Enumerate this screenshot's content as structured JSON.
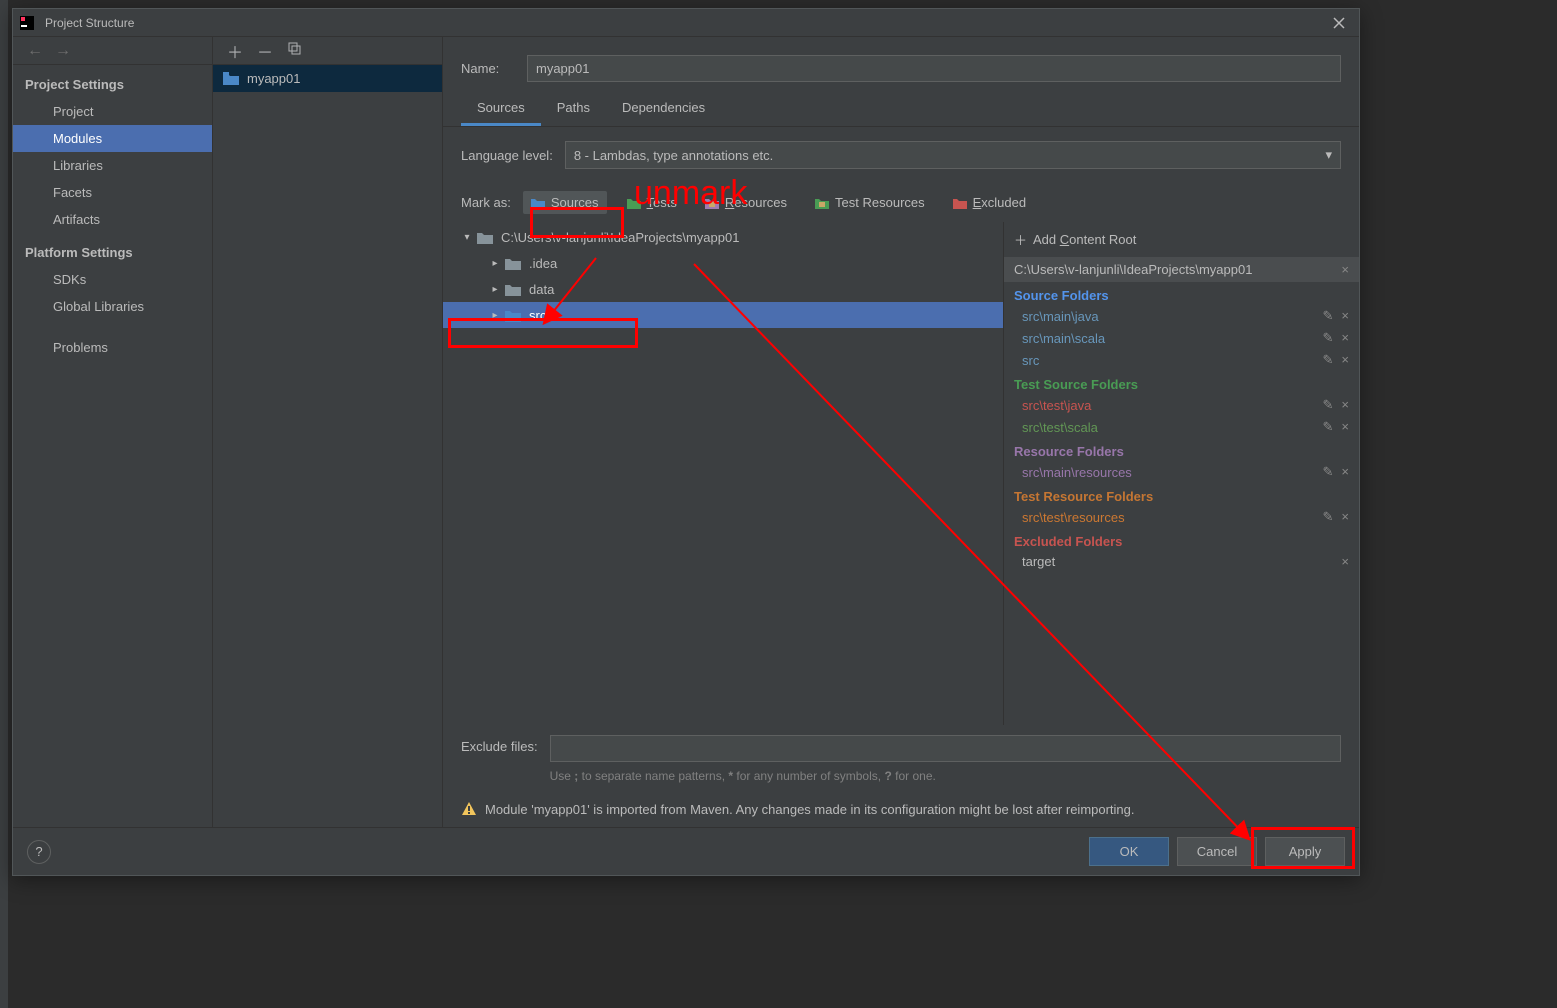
{
  "window": {
    "title": "Project Structure"
  },
  "sidebar": {
    "projectSettings": "Project Settings",
    "platformSettings": "Platform Settings",
    "items": {
      "project": "Project",
      "modules": "Modules",
      "libraries": "Libraries",
      "facets": "Facets",
      "artifacts": "Artifacts",
      "sdks": "SDKs",
      "globalLibraries": "Global Libraries",
      "problems": "Problems"
    }
  },
  "modules": {
    "item0": "myapp01"
  },
  "namePanel": {
    "label": "Name:",
    "value": "myapp01"
  },
  "tabs": {
    "sources": "Sources",
    "paths": "Paths",
    "dependencies": "Dependencies"
  },
  "langLevel": {
    "label": "Language level:",
    "value": "8 - Lambdas, type annotations etc."
  },
  "markAs": {
    "label": "Mark as:",
    "sources": "Sources",
    "tests": "Tests",
    "resources": "Resources",
    "testResources": "Test Resources",
    "excluded": "Excluded"
  },
  "tree": {
    "root": "C:\\Users\\v-lanjunli\\IdeaProjects\\myapp01",
    "idea": ".idea",
    "data": "data",
    "src": "src"
  },
  "roots": {
    "addContentRoot": "Add Content Root",
    "contentRoot": "C:\\Users\\v-lanjunli\\IdeaProjects\\myapp01",
    "sourceFolders": "Source Folders",
    "srcMainJava": "src\\main\\java",
    "srcMainScala": "src\\main\\scala",
    "src": "src",
    "testSourceFolders": "Test Source Folders",
    "srcTestJava": "src\\test\\java",
    "srcTestScala": "src\\test\\scala",
    "resourceFolders": "Resource Folders",
    "srcMainResources": "src\\main\\resources",
    "testResourceFolders": "Test Resource Folders",
    "srcTestResources": "src\\test\\resources",
    "excludedFolders": "Excluded Folders",
    "target": "target"
  },
  "exclude": {
    "label": "Exclude files:",
    "hint1": "Use ; to separate name patterns, * for any number of symbols, ? for one."
  },
  "warning": "Module 'myapp01' is imported from Maven. Any changes made in its configuration might be lost after reimporting.",
  "footer": {
    "ok": "OK",
    "cancel": "Cancel",
    "apply": "Apply"
  },
  "annotation": {
    "unmark": "unmark"
  }
}
